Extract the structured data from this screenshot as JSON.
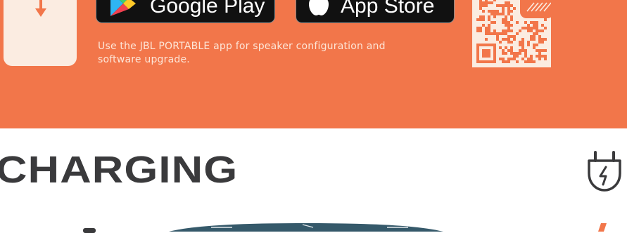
{
  "app_section": {
    "google_play_label": "Google Play",
    "app_store_label": "App Store",
    "description": "Use the JBL PORTABLE app for speaker configuration and software upgrade."
  },
  "charging_section": {
    "title": "CHARGING"
  },
  "colors": {
    "band": "#f2764a",
    "card": "#fbece1",
    "heading": "#3a3a3c",
    "speaker": "#35596a"
  },
  "icons": [
    "download-arrow-icon",
    "google-play-icon",
    "apple-icon",
    "qr-code-icon",
    "plug-bolt-icon"
  ]
}
